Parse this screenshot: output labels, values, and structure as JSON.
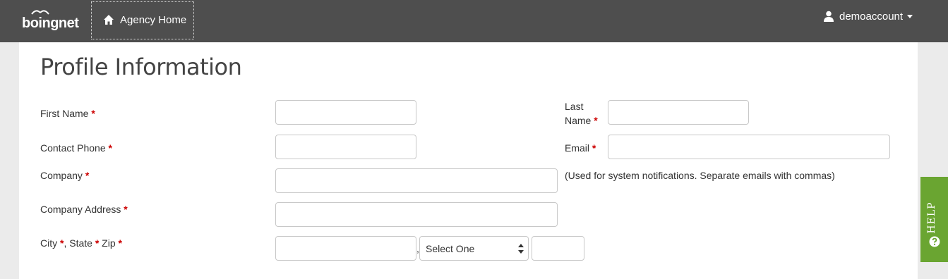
{
  "header": {
    "logo_text": "boingnet",
    "agency_home_label": "Agency Home",
    "username": "demoaccount"
  },
  "main": {
    "title": "Profile Information",
    "required_marker": "*",
    "fields": {
      "first_name": {
        "label": "First Name",
        "value": ""
      },
      "last_name": {
        "label_line1": "Last",
        "label_line2": "Name",
        "value": ""
      },
      "contact_phone": {
        "label": "Contact Phone",
        "value": ""
      },
      "email": {
        "label": "Email",
        "value": "",
        "note": "(Used for system notifications. Separate emails with commas)"
      },
      "company": {
        "label": "Company",
        "value": ""
      },
      "company_address": {
        "label": "Company Address",
        "value": ""
      },
      "city_state_zip": {
        "label_city": "City",
        "label_state": ", State",
        "label_zip": " Zip",
        "city_value": "",
        "state_selected": "Select One",
        "zip_value": "",
        "separator": ","
      }
    }
  },
  "help": {
    "label": "HELP"
  },
  "icons": {
    "home": "home-icon",
    "user": "user-icon",
    "caret": "caret-down-icon",
    "help": "question-circle-icon",
    "select_arrows": "select-arrows-icon"
  },
  "colors": {
    "topbar": "#4e4e4e",
    "required": "#cc0000",
    "help_tab": "#6aa531"
  }
}
